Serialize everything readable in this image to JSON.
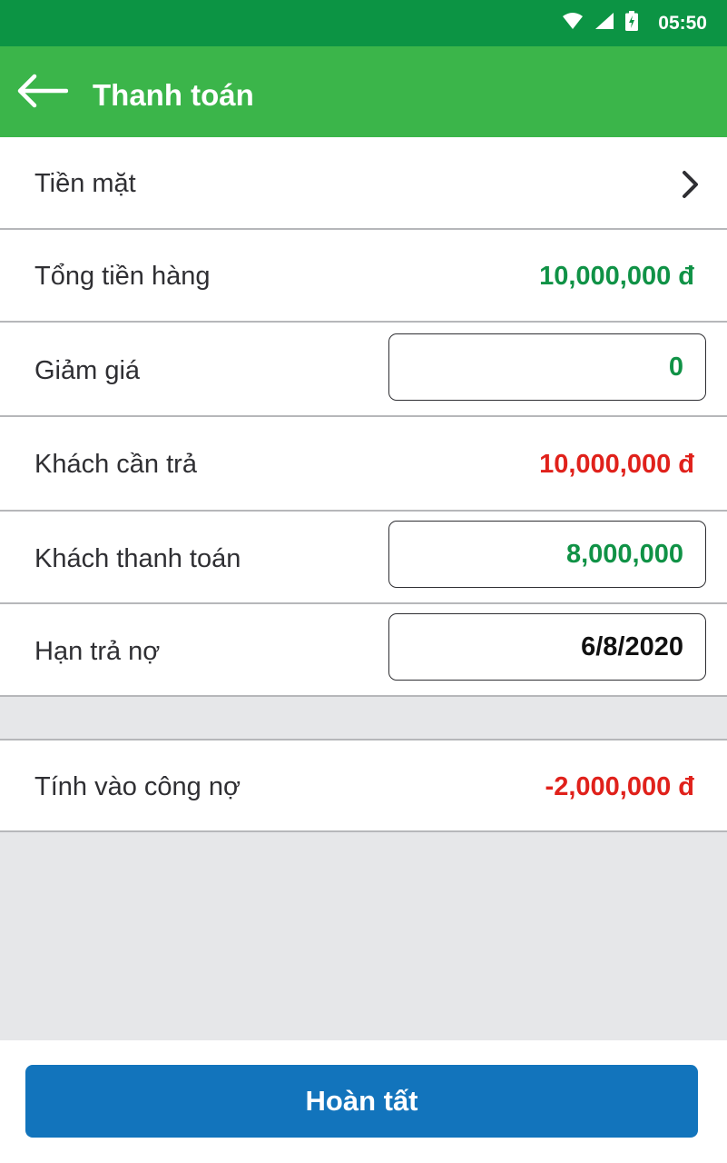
{
  "status_bar": {
    "time": "05:50",
    "icons": [
      "wifi-icon",
      "cell-signal-icon",
      "battery-charging-icon"
    ],
    "color": "#0c9444"
  },
  "app_bar": {
    "title": "Thanh toán",
    "back_icon": "arrow-left-icon",
    "color": "#3bb54a"
  },
  "payment_method": {
    "label": "Tiền mặt",
    "icon": "chevron-right-icon"
  },
  "rows": {
    "subtotal": {
      "label": "Tổng tiền hàng",
      "value": "10,000,000 đ"
    },
    "discount": {
      "label": "Giảm giá",
      "value": "0"
    },
    "amount_due": {
      "label": "Khách cần trả",
      "value": "10,000,000 đ"
    },
    "customer_paid": {
      "label": "Khách thanh toán",
      "value": "8,000,000"
    },
    "due_date": {
      "label": "Hạn trả nợ",
      "value": "6/8/2020"
    },
    "debt": {
      "label": "Tính vào công nợ",
      "value": "-2,000,000 đ"
    }
  },
  "colors": {
    "positive": "#109246",
    "negative": "#e0211b",
    "primary_button": "#1274bc"
  },
  "footer": {
    "done_label": "Hoàn tất"
  }
}
